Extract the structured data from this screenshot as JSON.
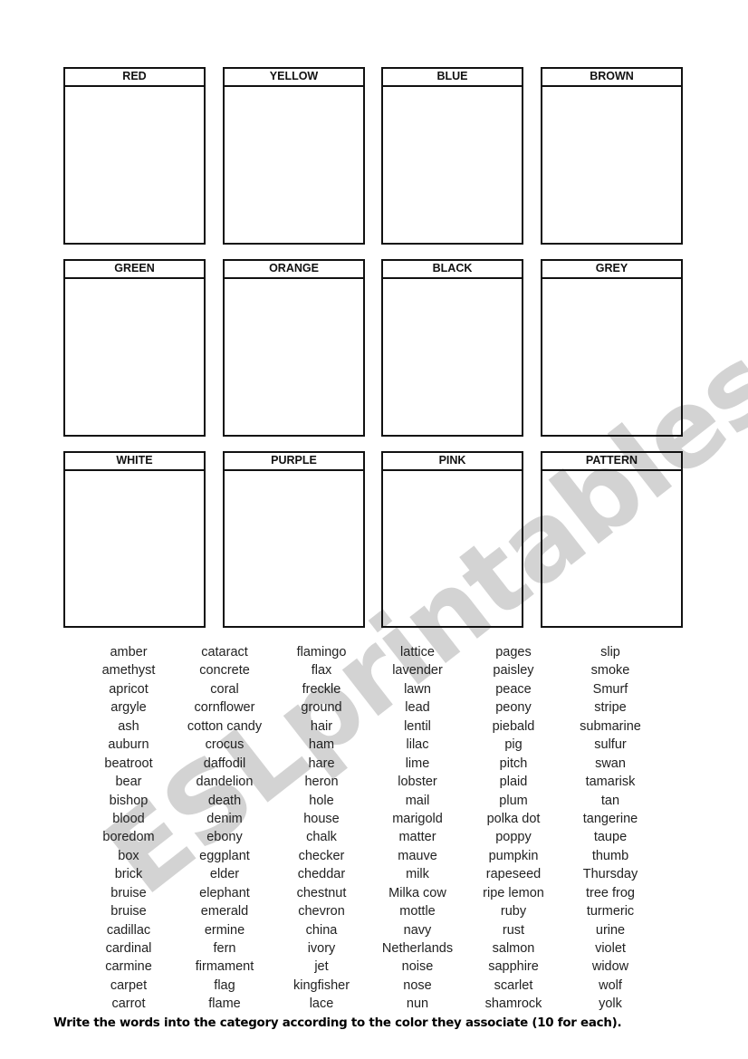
{
  "categories": [
    {
      "label": "RED"
    },
    {
      "label": "YELLOW"
    },
    {
      "label": "BLUE"
    },
    {
      "label": "BROWN"
    },
    {
      "label": "GREEN"
    },
    {
      "label": "ORANGE"
    },
    {
      "label": "BLACK"
    },
    {
      "label": "GREY"
    },
    {
      "label": "WHITE"
    },
    {
      "label": "PURPLE"
    },
    {
      "label": "PINK"
    },
    {
      "label": "PATTERN"
    }
  ],
  "word_columns": [
    [
      "amber",
      "amethyst",
      "apricot",
      "argyle",
      "ash",
      "auburn",
      "beatroot",
      "bear",
      "bishop",
      "blood",
      "boredom",
      "box",
      "brick",
      "bruise",
      "bruise",
      "cadillac",
      "cardinal",
      "carmine",
      "carpet",
      "carrot"
    ],
    [
      "cataract",
      "concrete",
      "coral",
      "cornflower",
      "cotton candy",
      "crocus",
      "daffodil",
      "dandelion",
      "death",
      "denim",
      "ebony",
      "eggplant",
      "elder",
      "elephant",
      "emerald",
      "ermine",
      "fern",
      "firmament",
      "flag",
      "flame"
    ],
    [
      "flamingo",
      "flax",
      "freckle",
      "ground",
      "hair",
      "ham",
      "hare",
      "heron",
      "hole",
      "house",
      "chalk",
      "checker",
      "cheddar",
      "chestnut",
      "chevron",
      "china",
      "ivory",
      "jet",
      "kingfisher",
      "lace"
    ],
    [
      "lattice",
      "lavender",
      "lawn",
      "lead",
      "lentil",
      "lilac",
      "lime",
      "lobster",
      "mail",
      "marigold",
      "matter",
      "mauve",
      "milk",
      "Milka cow",
      "mottle",
      "navy",
      "Netherlands",
      "noise",
      "nose",
      "nun"
    ],
    [
      "pages",
      "paisley",
      "peace",
      "peony",
      "piebald",
      "pig",
      "pitch",
      "plaid",
      "plum",
      "polka dot",
      "poppy",
      "pumpkin",
      "rapeseed",
      "ripe lemon",
      "ruby",
      "rust",
      "salmon",
      "sapphire",
      "scarlet",
      "shamrock"
    ],
    [
      "slip",
      "smoke",
      "Smurf",
      "stripe",
      "submarine",
      "sulfur",
      "swan",
      "tamarisk",
      "tan",
      "tangerine",
      "taupe",
      "thumb",
      "Thursday",
      "tree frog",
      "turmeric",
      "urine",
      "violet",
      "widow",
      "wolf",
      "yolk"
    ]
  ],
  "instruction": "Write the words into the category according to the color they associate (10 for each).",
  "watermark": "ESLprintables.com"
}
